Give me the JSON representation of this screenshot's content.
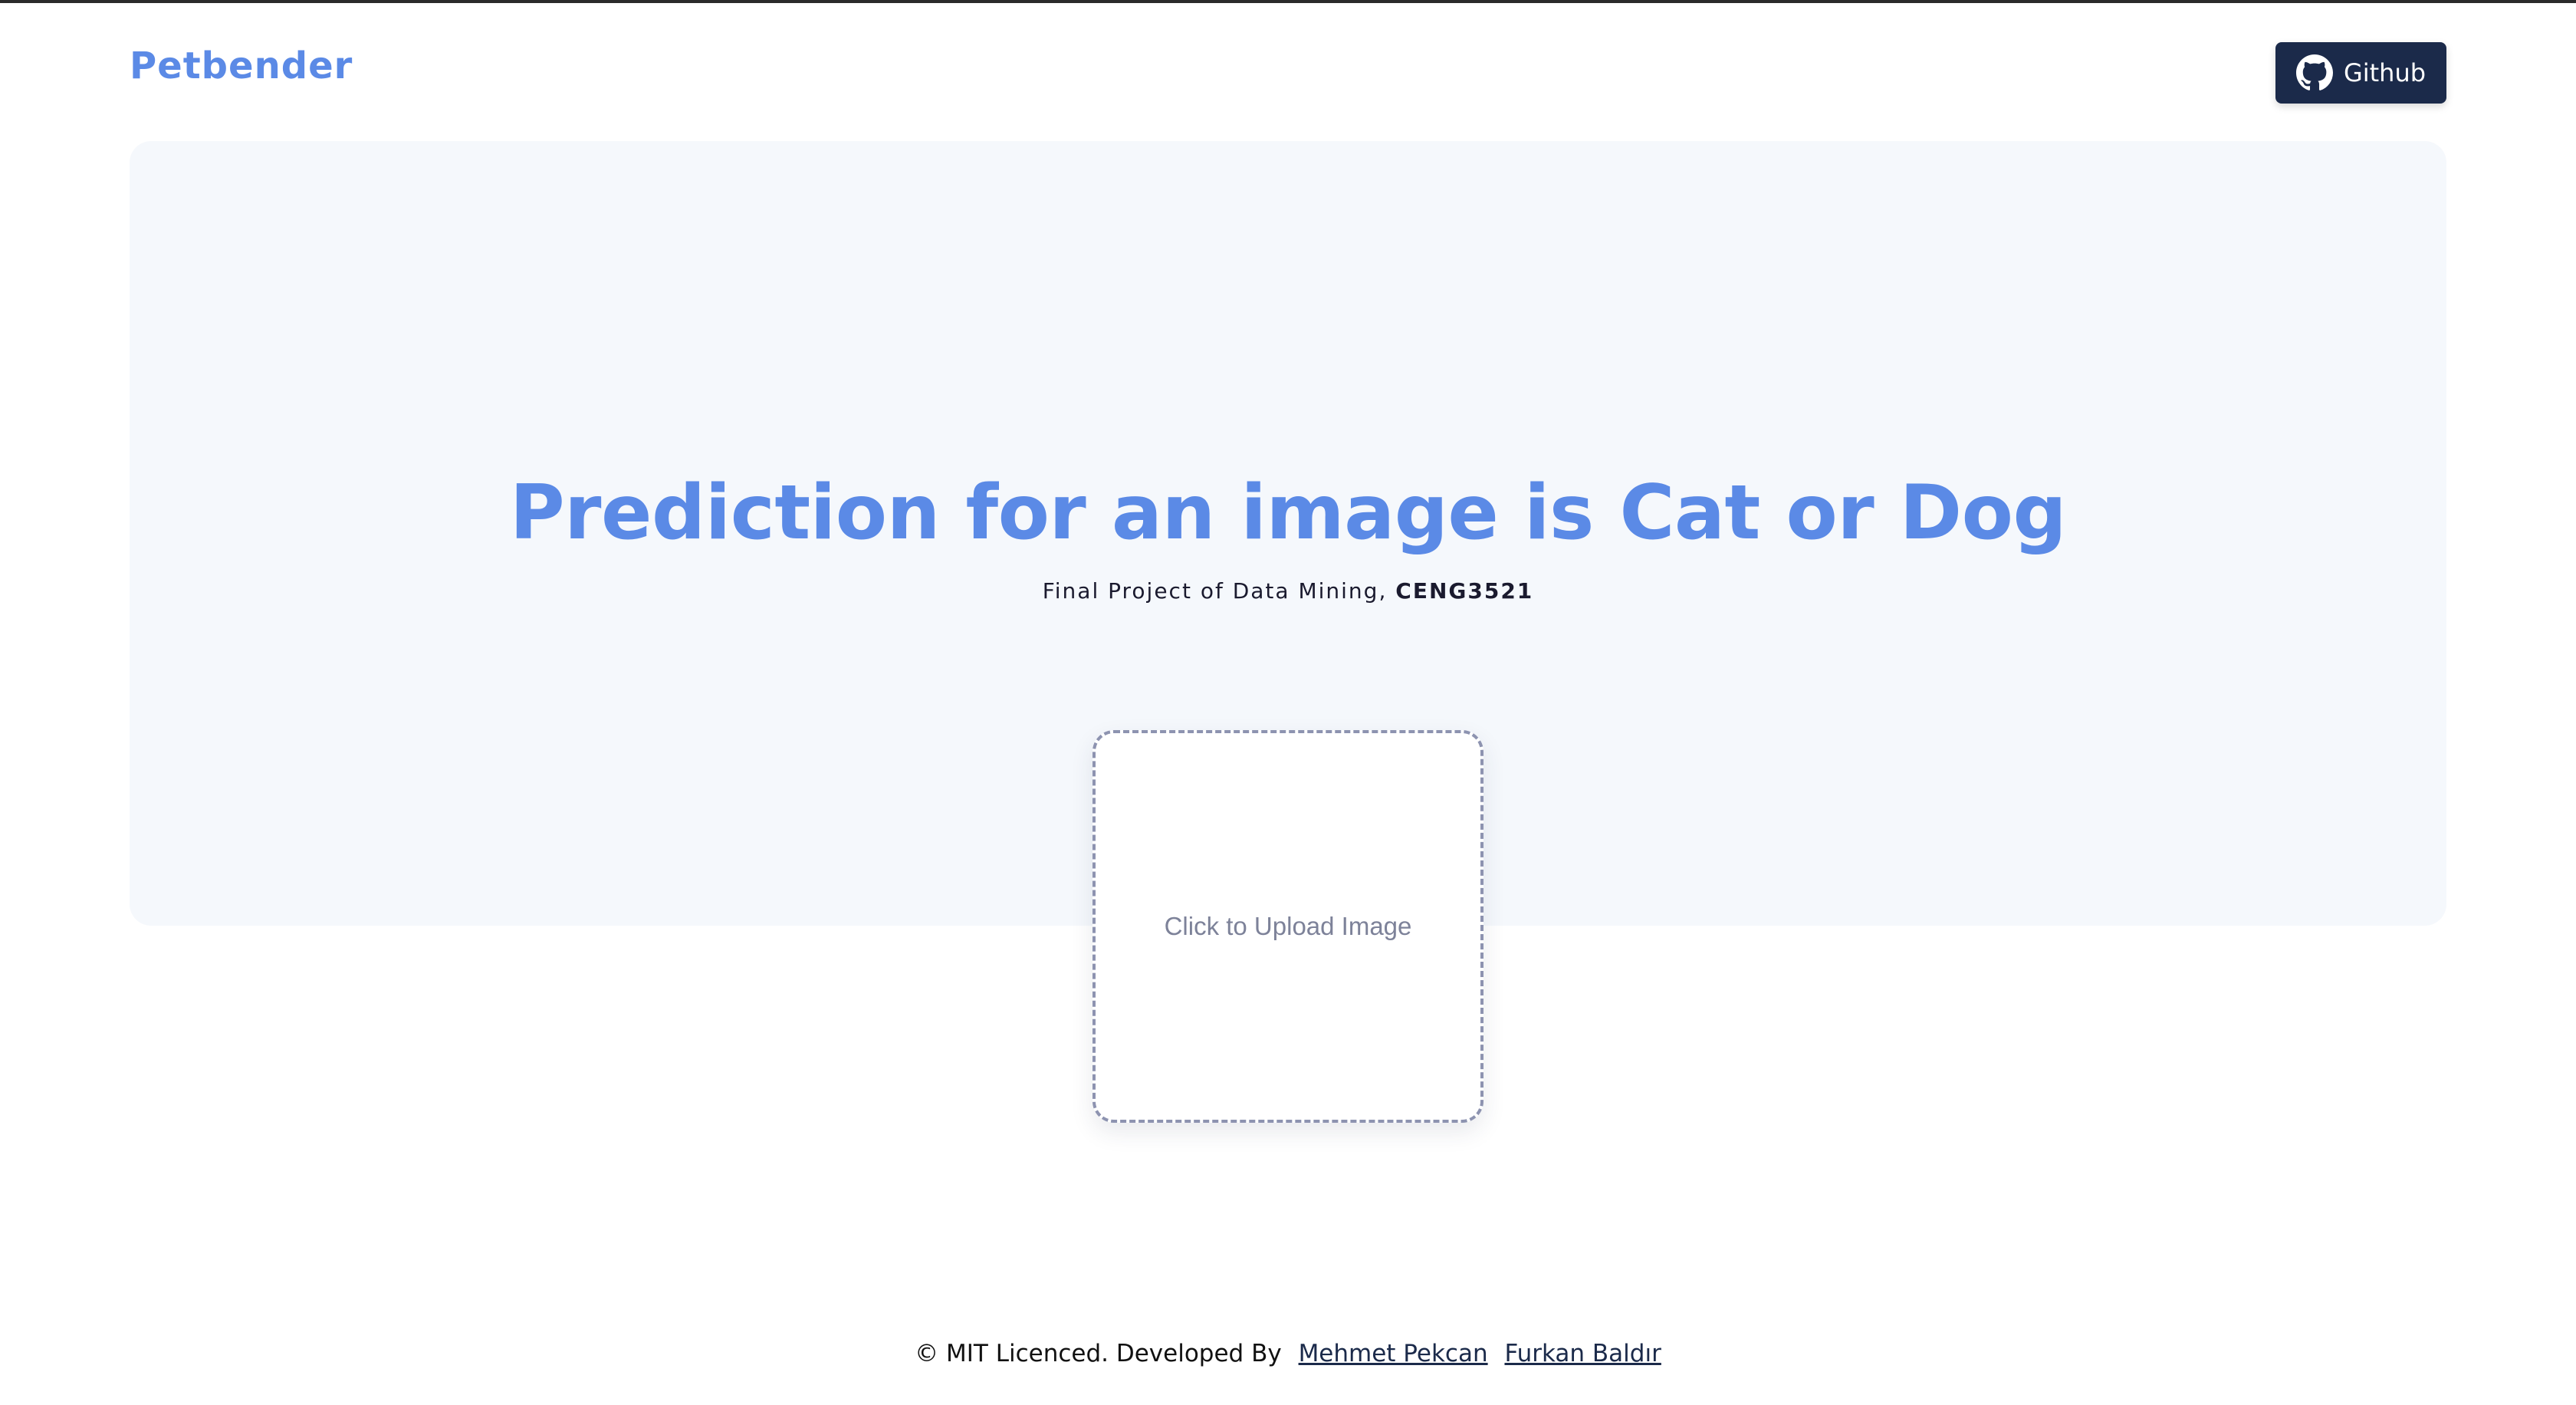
{
  "header": {
    "brand": "Petbender",
    "github_label": "Github",
    "github_icon": "github-icon"
  },
  "hero": {
    "title": "Prediction for an image is Cat or Dog",
    "subtitle_prefix": "Final Project of Data Mining,",
    "subtitle_code": "CENG3521"
  },
  "upload": {
    "label": "Click to Upload Image"
  },
  "footer": {
    "text": "© MIT Licenced. Developed By",
    "authors": [
      "Mehmet Pekcan",
      "Furkan Baldır"
    ]
  },
  "colors": {
    "accent": "#5b8ae6",
    "button_bg": "#1b2a4a",
    "hero_bg": "#f5f8fc",
    "upload_border": "#8d93b0"
  }
}
